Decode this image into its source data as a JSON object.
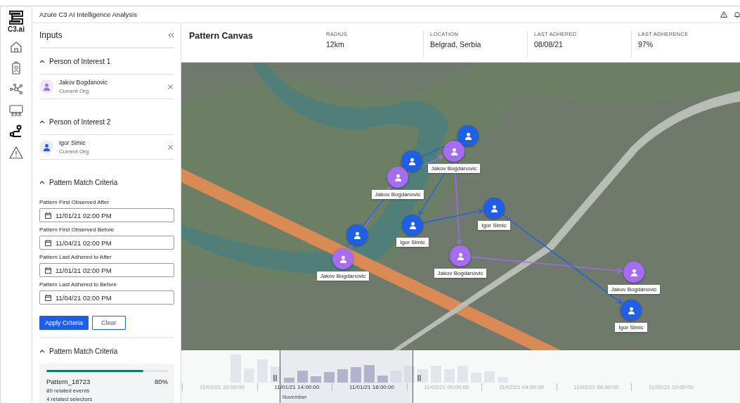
{
  "app": {
    "logo": "C3.ai",
    "title": "Azure C3 AI Intelligence Analysis"
  },
  "rail": [
    {
      "selected": false
    },
    {
      "selected": false
    },
    {
      "selected": false
    },
    {
      "selected": false
    },
    {
      "selected": true
    },
    {
      "selected": false
    }
  ],
  "inputs": {
    "title": "Inputs",
    "persons": [
      {
        "heading": "Person of Interest 1",
        "name": "Jakov Bogdanovic",
        "org": "Current Org",
        "color": "#a66cf2"
      },
      {
        "heading": "Person of Interest 2",
        "name": "Igor Simic",
        "org": "Current Org",
        "color": "#1f5fe8"
      }
    ],
    "criteria": {
      "heading": "Pattern Match Criteria",
      "fields": [
        {
          "label": "Pattern First Observed After",
          "value": "11/01/21 02:00 PM"
        },
        {
          "label": "Pattern First Observed Before",
          "value": "11/04/21 02:00 PM"
        },
        {
          "label": "Pattern Last Adhered to After",
          "value": "11/01/21 02:00 PM"
        },
        {
          "label": "Pattern Last Adhered to Before",
          "value": "11/04/21 02:00 PM"
        }
      ],
      "buttons": [
        {
          "label": "Apply Criteria",
          "kind": "primary"
        },
        {
          "label": "Clear",
          "kind": "secondary"
        }
      ]
    },
    "results": {
      "heading": "Pattern Match Criteria",
      "patterns": [
        {
          "name": "Pattern_18723",
          "percent": "80%",
          "level": 0.8,
          "lines": [
            "89 related events",
            "4 related selectors"
          ]
        }
      ]
    }
  },
  "canvas": {
    "title": "Pattern Canvas",
    "stats": [
      {
        "label": "RADIUS",
        "value": "12km"
      },
      {
        "label": "LOCATION",
        "value": "Belgrad, Serbia"
      },
      {
        "label": "LAST ADHERED",
        "value": "08/08/21"
      },
      {
        "label": "LAST ADHERENCE",
        "value": "97%"
      }
    ],
    "markers": [
      {
        "color": "#1f5fe8"
      },
      {
        "color": "#a66cf2",
        "label": "Jakov Bogdanovic"
      },
      {
        "color": "#1f5fe8"
      },
      {
        "color": "#a66cf2",
        "label": "Jakov Bogdanovic"
      },
      {
        "color": "#1f5fe8"
      },
      {
        "color": "#a66cf2",
        "label": "Jakov Bogdanovic"
      },
      {
        "color": "#1f5fe8",
        "label": "Igor Simic"
      },
      {
        "color": "#a66cf2",
        "label": "Jakov Bogdanovic"
      },
      {
        "color": "#1f5fe8",
        "label": "Igor Simic"
      },
      {
        "color": "#a66cf2",
        "label": "Jakov Bogdanovic"
      },
      {
        "color": "#1f5fe8",
        "label": "Igor Simic"
      }
    ]
  },
  "timeline": {
    "ticks": [
      "11/01/21 10:00:00",
      "11/01/21 14:00:00",
      "11/01/21 18:00:00",
      "11/02/21 00:00:00",
      "11/02/21 04:00:00",
      "11/02/21 08:00:00",
      "11/02/21 10:00:00"
    ],
    "month": "November"
  }
}
